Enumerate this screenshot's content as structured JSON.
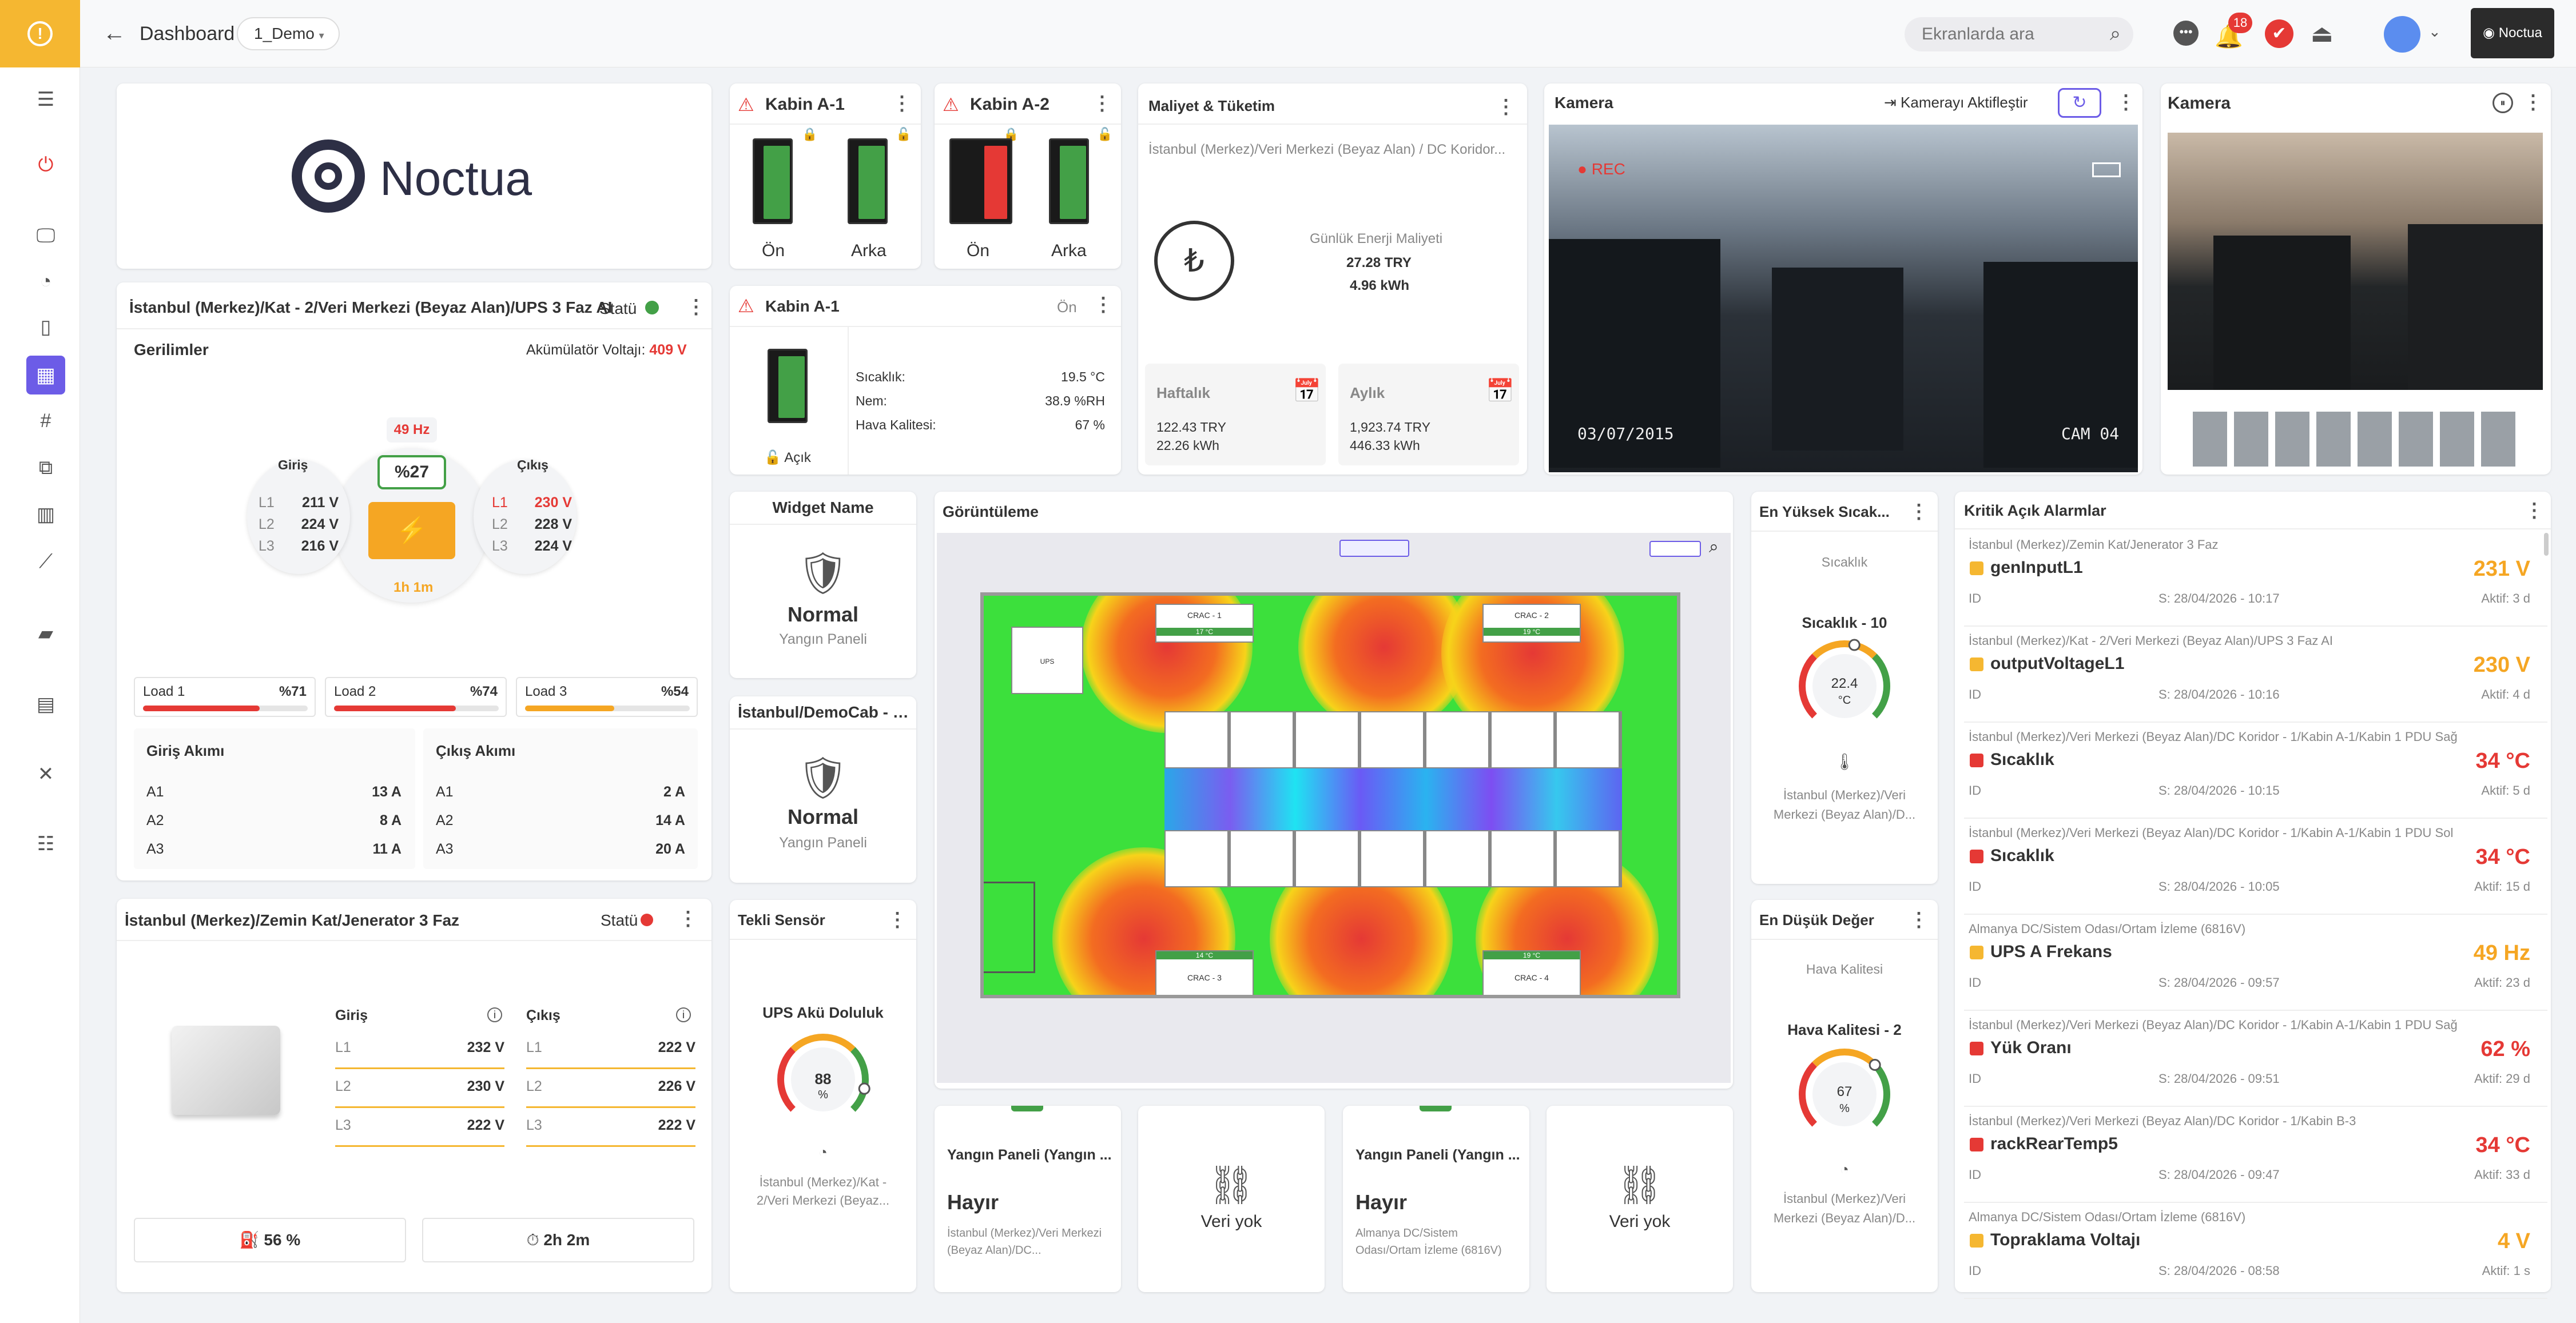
{
  "topbar": {
    "back_label": "Dashboard",
    "demo_select": "1_Demo",
    "search_placeholder": "Ekranlarda ara",
    "notif_count": "18",
    "logo_text": "Noctua"
  },
  "logo_card": {
    "brand": "Noctua"
  },
  "ups": {
    "title": "İstanbul (Merkez)/Kat - 2/Veri Merkezi (Beyaz Alan)/UPS 3 Faz AI",
    "status_label": "Statü",
    "section": "Gerilimler",
    "battery_label": "Akümülatör Voltajı:",
    "battery_value": "409 V",
    "freq": "49 Hz",
    "percent": "%27",
    "runtime": "1h 1m",
    "in_label": "Giriş",
    "out_label": "Çıkış",
    "in": [
      {
        "l": "L1",
        "v": "211 V"
      },
      {
        "l": "L2",
        "v": "224 V"
      },
      {
        "l": "L3",
        "v": "216 V"
      }
    ],
    "out": [
      {
        "l": "L1",
        "v": "230 V"
      },
      {
        "l": "L2",
        "v": "228 V"
      },
      {
        "l": "L3",
        "v": "224 V"
      }
    ],
    "loads": [
      {
        "label": "Load 1",
        "value": "%71",
        "pct": 71
      },
      {
        "label": "Load 2",
        "value": "%74",
        "pct": 74
      },
      {
        "label": "Load 3",
        "value": "%54",
        "pct": 54
      }
    ],
    "in_current_title": "Giriş Akımı",
    "out_current_title": "Çıkış Akımı",
    "in_current": [
      {
        "l": "A1",
        "v": "13 A"
      },
      {
        "l": "A2",
        "v": "8 A"
      },
      {
        "l": "A3",
        "v": "11 A"
      }
    ],
    "out_current": [
      {
        "l": "A1",
        "v": "2 A"
      },
      {
        "l": "A2",
        "v": "14 A"
      },
      {
        "l": "A3",
        "v": "20 A"
      }
    ]
  },
  "gen": {
    "title": "İstanbul (Merkez)/Zemin Kat/Jenerator 3 Faz",
    "status_label": "Statü",
    "in_label": "Giriş",
    "out_label": "Çıkış",
    "in": [
      {
        "l": "L1",
        "v": "232 V"
      },
      {
        "l": "L2",
        "v": "230 V"
      },
      {
        "l": "L3",
        "v": "222 V"
      }
    ],
    "out": [
      {
        "l": "L1",
        "v": "222 V"
      },
      {
        "l": "L2",
        "v": "226 V"
      },
      {
        "l": "L3",
        "v": "222 V"
      }
    ],
    "fuel": "56 %",
    "runtime": "2h 2m"
  },
  "cab_a1": {
    "title": "Kabin A-1",
    "front": "Ön",
    "back": "Arka"
  },
  "cab_a2": {
    "title": "Kabin A-2",
    "front": "Ön",
    "back": "Arka"
  },
  "cab_a1_env": {
    "title": "Kabin A-1",
    "side": "Ön",
    "temp_label": "Sıcaklık:",
    "temp": "19.5 °C",
    "hum_label": "Nem:",
    "hum": "38.9 %RH",
    "air_label": "Hava Kalitesi:",
    "air": "67 %",
    "lock": "Açık"
  },
  "cost": {
    "title": "Maliyet & Tüketim",
    "path": "İstanbul (Merkez)/Veri Merkezi (Beyaz Alan) / DC Koridor...",
    "daily_label": "Günlük Enerji Maliyeti",
    "daily_try": "27.28 TRY",
    "daily_kwh": "4.96 kWh",
    "weekly_label": "Haftalık",
    "weekly_try": "122.43 TRY",
    "weekly_kwh": "22.26 kWh",
    "monthly_label": "Aylık",
    "monthly_try": "1,923.74 TRY",
    "monthly_kwh": "446.33 kWh"
  },
  "cam1": {
    "title": "Kamera",
    "activate": "Kamerayı Aktifleştir",
    "rec": "REC",
    "date": "03/07/2015",
    "cam": "CAM 04"
  },
  "cam2": {
    "title": "Kamera"
  },
  "widget1": {
    "title": "Widget Name",
    "state": "Normal",
    "sub": "Yangın Paneli"
  },
  "widget2": {
    "title": "İstanbul/DemoCab - 0...",
    "state": "Normal",
    "sub": "Yangın Paneli"
  },
  "single": {
    "title": "Tekli Sensör",
    "label": "UPS Akü Doluluk",
    "value": "88",
    "unit": "%",
    "gauge_pct": 88,
    "path": "İstanbul (Merkez)/Kat - 2/Veri Merkezi (Beyaz..."
  },
  "view": {
    "title": "Görüntüleme",
    "crac1": "CRAC - 1",
    "crac2": "CRAC - 2",
    "crac3": "CRAC - 3",
    "crac4": "CRAC - 4",
    "t1": "17 °C",
    "t2": "19 °C",
    "t3": "14 °C",
    "t4": "19 °C",
    "ups": "UPS"
  },
  "highest": {
    "title": "En Yüksek Sıcak...",
    "sub": "Sıcaklık",
    "label": "Sıcaklık - 10",
    "value": "22.4",
    "unit": "°C",
    "gauge_pct": 55,
    "path": "İstanbul (Merkez)/Veri Merkezi (Beyaz Alan)/D..."
  },
  "lowest": {
    "title": "En Düşük Değer",
    "sub": "Hava Kalitesi",
    "label": "Hava Kalitesi - 2",
    "value": "67",
    "unit": "%",
    "gauge_pct": 67,
    "path": "İstanbul (Merkez)/Veri Merkezi (Beyaz Alan)/D..."
  },
  "fire1": {
    "title": "Yangın Paneli (Yangın ...",
    "value": "Hayır",
    "path": "İstanbul (Merkez)/Veri Merkezi (Beyaz Alan)/DC..."
  },
  "nodata1": {
    "text": "Veri yok"
  },
  "fire2": {
    "title": "Yangın Paneli (Yangın ...",
    "value": "Hayır",
    "path": "Almanya DC/Sistem Odası/Ortam İzleme (6816V)"
  },
  "nodata2": {
    "text": "Veri yok"
  },
  "alarms": {
    "title": "Kritik Açık Alarmlar",
    "items": [
      {
        "path": "İstanbul (Merkez)/Zemin Kat/Jenerator 3 Faz",
        "name": "genInputL1",
        "value": "231 V",
        "id": "ID",
        "since": "S: 28/04/2026 - 10:17",
        "active": "Aktif: 3 d",
        "color": "#f5b731"
      },
      {
        "path": "İstanbul (Merkez)/Kat - 2/Veri Merkezi (Beyaz Alan)/UPS 3 Faz AI",
        "name": "outputVoltageL1",
        "value": "230 V",
        "id": "ID",
        "since": "S: 28/04/2026 - 10:16",
        "active": "Aktif: 4 d",
        "color": "#f5b731"
      },
      {
        "path": "İstanbul (Merkez)/Veri Merkezi (Beyaz Alan)/DC Koridor - 1/Kabin A-1/Kabin 1 PDU Sağ",
        "name": "Sıcaklık",
        "value": "34 °C",
        "id": "ID",
        "since": "S: 28/04/2026 - 10:15",
        "active": "Aktif: 5 d",
        "color": "#e53935"
      },
      {
        "path": "İstanbul (Merkez)/Veri Merkezi (Beyaz Alan)/DC Koridor - 1/Kabin A-1/Kabin 1 PDU Sol",
        "name": "Sıcaklık",
        "value": "34 °C",
        "id": "ID",
        "since": "S: 28/04/2026 - 10:05",
        "active": "Aktif: 15 d",
        "color": "#e53935"
      },
      {
        "path": "Almanya DC/Sistem Odası/Ortam İzleme (6816V)",
        "name": "UPS A Frekans",
        "value": "49 Hz",
        "id": "ID",
        "since": "S: 28/04/2026 - 09:57",
        "active": "Aktif: 23 d",
        "color": "#f5b731"
      },
      {
        "path": "İstanbul (Merkez)/Veri Merkezi (Beyaz Alan)/DC Koridor - 1/Kabin A-1/Kabin 1 PDU Sağ",
        "name": "Yük Oranı",
        "value": "62 %",
        "id": "ID",
        "since": "S: 28/04/2026 - 09:51",
        "active": "Aktif: 29 d",
        "color": "#e53935"
      },
      {
        "path": "İstanbul (Merkez)/Veri Merkezi (Beyaz Alan)/DC Koridor - 1/Kabin B-3",
        "name": "rackRearTemp5",
        "value": "34 °C",
        "id": "ID",
        "since": "S: 28/04/2026 - 09:47",
        "active": "Aktif: 33 d",
        "color": "#e53935"
      },
      {
        "path": "Almanya DC/Sistem Odası/Ortam İzleme (6816V)",
        "name": "Topraklama Voltajı",
        "value": "4 V",
        "id": "ID",
        "since": "S: 28/04/2026 - 08:58",
        "active": "Aktif: 1 s",
        "color": "#f5b731"
      }
    ]
  },
  "colors": {
    "accent": "#f5a623",
    "brand_purple": "#6c5ce7",
    "danger": "#e53935",
    "ok": "#43a047"
  }
}
